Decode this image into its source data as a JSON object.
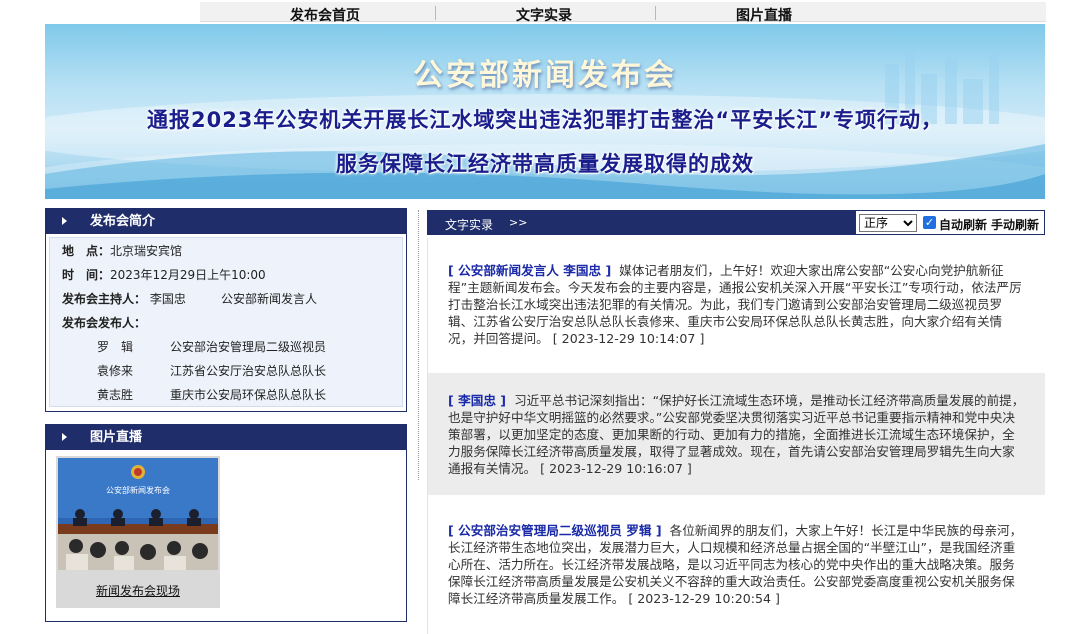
{
  "nav": {
    "home": "发布会首页",
    "text": "文字实录",
    "photo": "图片直播"
  },
  "banner": {
    "title": "公安部新闻发布会",
    "line1": "通报2023年公安机关开展长江水域突出违法犯罪打击整治“平安长江”专项行动，",
    "line2": "服务保障长江经济带高质量发展取得的成效"
  },
  "intro": {
    "heading": "发布会简介",
    "location_label": "地　点：",
    "location": "北京瑞安宾馆",
    "time_label": "时　间：",
    "time": "2023年12月29日上午10:00",
    "host_label": "发布会主持人：",
    "host_name": "李国忠",
    "host_title": "公安部新闻发言人",
    "publishers_label": "发布会发布人：",
    "publishers": [
      {
        "name": "罗　辑",
        "title": "公安部治安管理局二级巡视员"
      },
      {
        "name": "袁修来",
        "title": "江苏省公安厅治安总队总队长"
      },
      {
        "name": "黄志胜",
        "title": "重庆市公安局环保总队总队长"
      }
    ]
  },
  "photos": {
    "heading": "图片直播",
    "caption": "新闻发布会现场",
    "backdrop_text": "公安部新闻发布会"
  },
  "feed": {
    "tab_label": "文字实录",
    "go_label": ">>",
    "order_options": [
      "正序"
    ],
    "order_selected": "正序",
    "auto_refresh_label": "自动刷新",
    "auto_refresh_checked": true,
    "manual_refresh_label": "手动刷新",
    "entries": [
      {
        "speaker": "[ 公安部新闻发言人 李国忠 ]",
        "text": "媒体记者朋友们，上午好！欢迎大家出席公安部“公安心向党护航新征程”主题新闻发布会。今天发布会的主要内容是，通报公安机关深入开展“平安长江”专项行动，依法严厉打击整治长江水域突出违法犯罪的有关情况。为此，我们专门邀请到公安部治安管理局二级巡视员罗辑、江苏省公安厅治安总队总队长袁修来、重庆市公安局环保总队总队长黄志胜，向大家介绍有关情况，并回答提问。",
        "time": "[  2023-12-29 10:14:07  ]"
      },
      {
        "speaker": "[ 李国忠 ]",
        "text": "习近平总书记深刻指出：“保护好长江流域生态环境，是推动长江经济带高质量发展的前提，也是守护好中华文明摇篮的必然要求。”公安部党委坚决贯彻落实习近平总书记重要指示精神和党中央决策部署，以更加坚定的态度、更加果断的行动、更加有力的措施，全面推进长江流域生态环境保护，全力服务保障长江经济带高质量发展，取得了显著成效。现在，首先请公安部治安管理局罗辑先生向大家通报有关情况。",
        "time": "[  2023-12-29 10:16:07  ]"
      },
      {
        "speaker": "[ 公安部治安管理局二级巡视员 罗辑 ]",
        "text": "各位新闻界的朋友们，大家上午好！长江是中华民族的母亲河，长江经济带生态地位突出，发展潜力巨大，人口规模和经济总量占据全国的“半壁江山”，是我国经济重心所在、活力所在。长江经济带发展战略，是以习近平同志为核心的党中央作出的重大战略决策。服务保障长江经济带高质量发展是公安机关义不容辞的重大政治责任。公安部党委高度重视公安机关服务保障长江经济带高质量发展工作。",
        "time": "[  2023-12-29 10:20:54  ]"
      }
    ]
  }
}
